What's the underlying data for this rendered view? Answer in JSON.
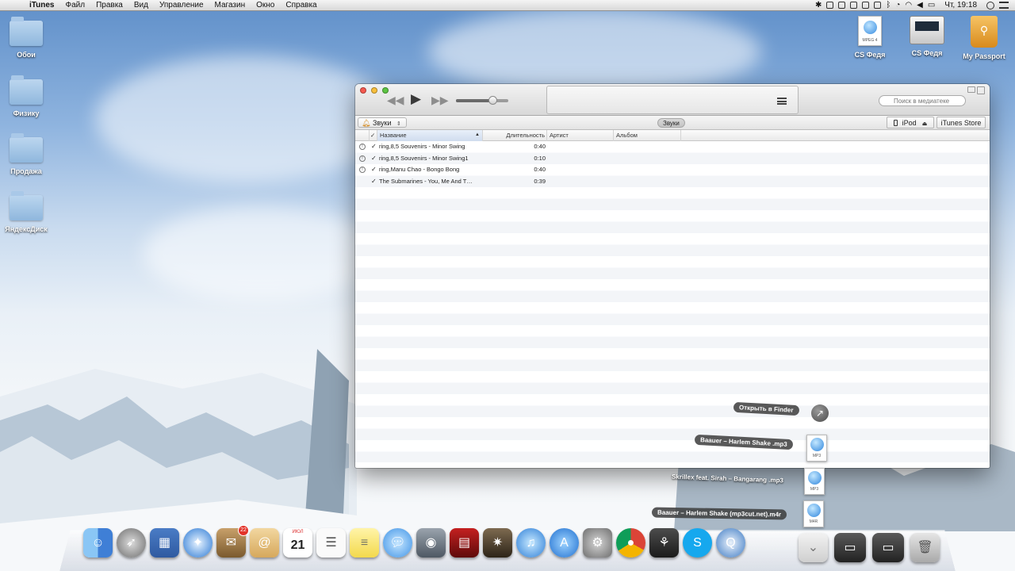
{
  "menubar": {
    "app": "iTunes",
    "items": [
      "Файл",
      "Правка",
      "Вид",
      "Управление",
      "Магазин",
      "Окно",
      "Справка"
    ],
    "clock": "Чт, 19:18"
  },
  "desktop_icons": {
    "left": [
      {
        "label": "Обои"
      },
      {
        "label": "Физику"
      },
      {
        "label": "Продажа"
      },
      {
        "label": "ЯндексДиск"
      }
    ],
    "top_right": [
      {
        "label": "CS Федя",
        "doc_tag": "MPEG 4"
      },
      {
        "label": "CS Федя"
      },
      {
        "label": "My Passport"
      }
    ]
  },
  "itunes": {
    "search_placeholder": "Поиск в медиатеке",
    "media_button": "Звуки",
    "center_tab": "Звуки",
    "device_button": "iPod",
    "store_button": "iTunes Store",
    "columns": {
      "name": "Название",
      "duration": "Длительность",
      "artist": "Артист",
      "album": "Альбом"
    },
    "volume": 0.7,
    "tracks": [
      {
        "name": "ring,8,5 Souvenirs - Minor Swing",
        "duration": "0:40",
        "warn": true
      },
      {
        "name": "ring,8,5 Souvenirs - Minor Swing1",
        "duration": "0:10",
        "warn": true
      },
      {
        "name": "ring,Manu Chao - Bongo Bong",
        "duration": "0:40",
        "warn": true
      },
      {
        "name": "The Submarines - You, Me And T…",
        "duration": "0:39",
        "warn": false
      }
    ]
  },
  "stack": {
    "open_finder": "Открыть в Finder",
    "items": [
      {
        "label": "Baauer – Harlem Shake .mp3",
        "tag": "MP3"
      },
      {
        "label": "Skrillex feat. Sirah – Bangarang .mp3",
        "tag": "MP3"
      },
      {
        "label": "Baauer – Harlem Shake (mp3cut.net).m4r",
        "tag": "M4R"
      }
    ]
  },
  "dock": {
    "calendar_month": "ИЮЛ",
    "calendar_day": "21",
    "mail_badge": "22"
  }
}
